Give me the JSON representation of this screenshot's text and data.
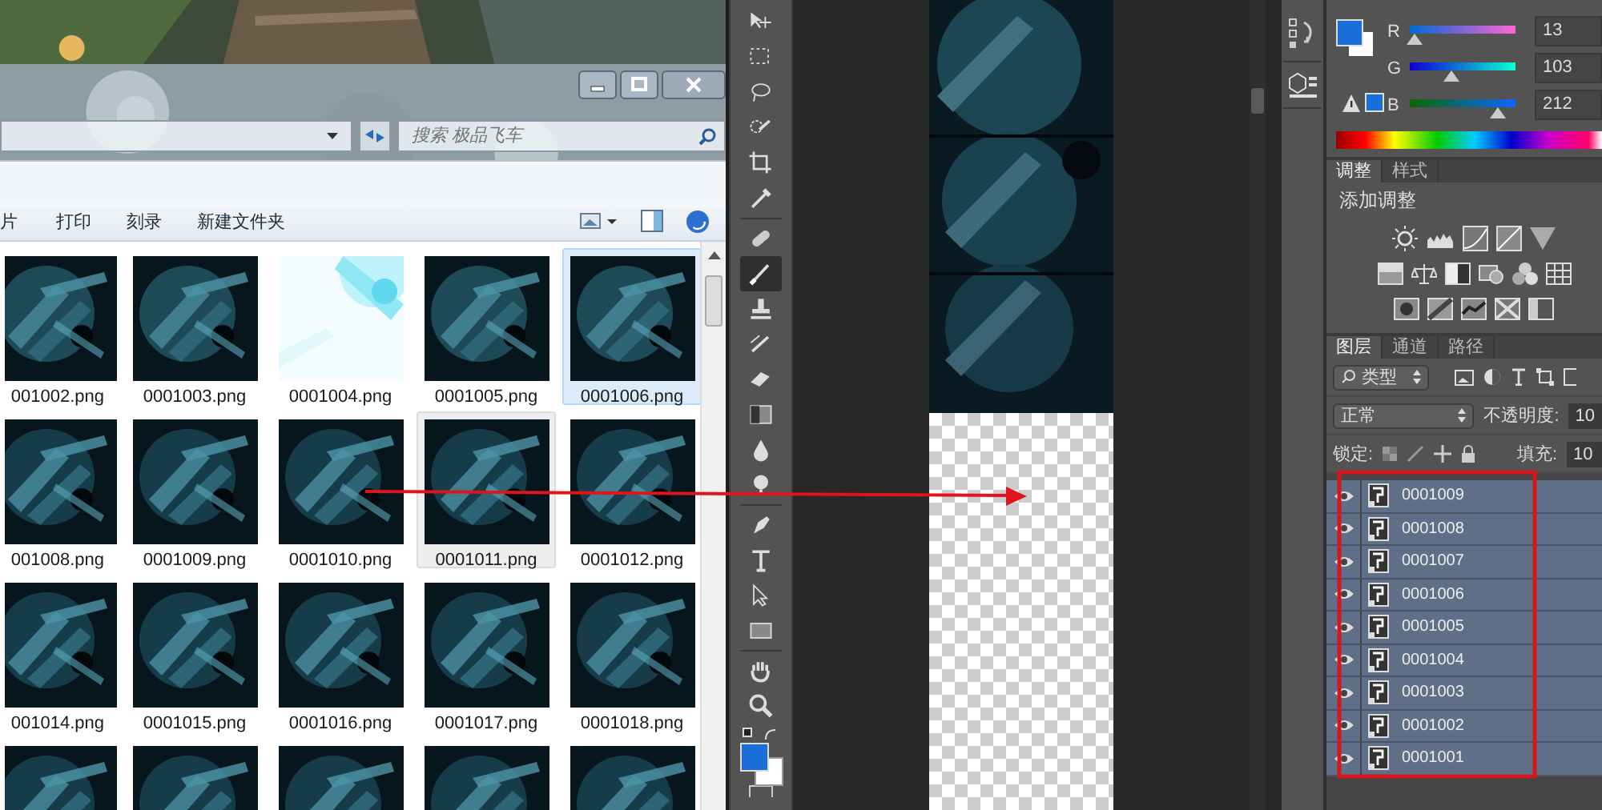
{
  "explorer": {
    "search": {
      "placeholder": "搜索 极品飞车"
    },
    "toolbar": [
      "片",
      "打印",
      "刻录",
      "新建文件夹"
    ],
    "files": [
      {
        "label": "001002.png",
        "selected": false,
        "hovered": false
      },
      {
        "label": "0001003.png",
        "selected": false,
        "hovered": false
      },
      {
        "label": "0001004.png",
        "selected": false,
        "hovered": false
      },
      {
        "label": "0001005.png",
        "selected": false,
        "hovered": false
      },
      {
        "label": "0001006.png",
        "selected": true,
        "hovered": false
      },
      {
        "label": "001008.png",
        "selected": false,
        "hovered": false
      },
      {
        "label": "0001009.png",
        "selected": false,
        "hovered": false
      },
      {
        "label": "0001010.png",
        "selected": false,
        "hovered": false
      },
      {
        "label": "0001011.png",
        "selected": false,
        "hovered": true
      },
      {
        "label": "0001012.png",
        "selected": false,
        "hovered": false
      },
      {
        "label": "001014.png",
        "selected": false,
        "hovered": false
      },
      {
        "label": "0001015.png",
        "selected": false,
        "hovered": false
      },
      {
        "label": "0001016.png",
        "selected": false,
        "hovered": false
      },
      {
        "label": "0001017.png",
        "selected": false,
        "hovered": false
      },
      {
        "label": "0001018.png",
        "selected": false,
        "hovered": false
      },
      {
        "selected": false,
        "hovered": false
      },
      {
        "selected": false,
        "hovered": false
      },
      {
        "selected": false,
        "hovered": false
      },
      {
        "selected": false,
        "hovered": false
      },
      {
        "selected": false,
        "hovered": false
      }
    ]
  },
  "photoshop": {
    "tools": [
      {
        "selected": false
      },
      {
        "selected": false
      },
      {
        "selected": false
      },
      {
        "selected": false
      },
      {
        "selected": false
      },
      {
        "selected": false
      },
      {
        "selected": false
      },
      {
        "selected": true
      },
      {
        "selected": false
      },
      {
        "selected": false
      },
      {
        "selected": false
      },
      {
        "selected": false
      },
      {
        "selected": false
      },
      {
        "selected": false
      },
      {
        "selected": false
      },
      {
        "selected": false
      },
      {
        "selected": false
      },
      {
        "selected": false
      },
      {
        "selected": false
      },
      {
        "selected": false
      }
    ],
    "color_panel": {
      "channels": [
        {
          "label": "R",
          "value": "13",
          "level": 0.05
        },
        {
          "label": "G",
          "value": "103",
          "level": 0.4
        },
        {
          "label": "B",
          "value": "212",
          "level": 0.83
        }
      ]
    },
    "adjustments": {
      "tabs": [
        {
          "label": "调整",
          "selected": true
        },
        {
          "label": "样式",
          "selected": false
        }
      ],
      "title": "添加调整"
    },
    "layers": {
      "tabs": [
        {
          "label": "图层",
          "selected": true
        },
        {
          "label": "通道",
          "selected": false
        },
        {
          "label": "路径",
          "selected": false
        }
      ],
      "filter": "类型",
      "blend_mode": "正常",
      "opacity_label": "不透明度:",
      "opacity": "10",
      "lock_label": "锁定:",
      "fill_label": "填充:",
      "fill": "10",
      "items": [
        {
          "name": "0001009",
          "visible": true,
          "selected": true
        },
        {
          "name": "0001008",
          "visible": true,
          "selected": true
        },
        {
          "name": "0001007",
          "visible": true,
          "selected": true
        },
        {
          "name": "0001006",
          "visible": true,
          "selected": true
        },
        {
          "name": "0001005",
          "visible": true,
          "selected": true
        },
        {
          "name": "0001004",
          "visible": true,
          "selected": true
        },
        {
          "name": "0001003",
          "visible": true,
          "selected": true
        },
        {
          "name": "0001002",
          "visible": true,
          "selected": true
        },
        {
          "name": "0001001",
          "visible": true,
          "selected": true
        }
      ]
    }
  }
}
